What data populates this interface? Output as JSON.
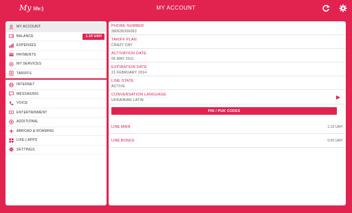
{
  "header": {
    "logo_my": "My",
    "logo_life": "life:)",
    "title": "MY ACCOUNT",
    "refresh_icon": "refresh-icon",
    "settings_icon": "gear-icon"
  },
  "sidebar": {
    "items": [
      {
        "label": "MY ACCOUNT",
        "icon": "user-icon"
      },
      {
        "label": "BALANCE",
        "icon": "wallet-icon",
        "badge": "1.19 UAH"
      },
      {
        "label": "EXPENSES",
        "icon": "chart-icon"
      },
      {
        "label": "PAYMENTS",
        "icon": "card-icon"
      },
      {
        "label": "MY SERVICES",
        "icon": "services-icon"
      },
      {
        "label": "TARIFFS",
        "icon": "tariffs-icon"
      },
      {
        "label": "INTERNET",
        "icon": "globe-icon"
      },
      {
        "label": "MESSAGING",
        "icon": "message-icon"
      },
      {
        "label": "VOICE",
        "icon": "phone-icon"
      },
      {
        "label": "ENTERTAINMENT",
        "icon": "entertainment-icon"
      },
      {
        "label": "ADDITIONAL",
        "icon": "plus-icon"
      },
      {
        "label": "ABROAD & ROAMING",
        "icon": "plane-icon"
      },
      {
        "label": "LIFE:) APPS",
        "icon": "apps-icon"
      },
      {
        "label": "SETTINGS",
        "icon": "settings-icon"
      }
    ]
  },
  "account": {
    "phone_label": "PHONE NUMBER",
    "phone_value": "380636306063",
    "tariff_label": "TARIFF PLAN",
    "tariff_value": "CRAZY DAY",
    "activation_label": "ACTIVATION DATE",
    "activation_value": "06 MAY 2011",
    "expiration_label": "EXPIRATION DATE",
    "expiration_value": "21 FEBRUARY 2014",
    "line_state_label": "LINE STATE",
    "line_state_value": "ACTIVE",
    "language_label": "CONVERSATION LANGUAGE",
    "language_value": "UKRAINIAN LATIN",
    "pin_button": "PIN / PUK CODES",
    "line_main_label": "LINE MAIN",
    "line_main_value": "1.19 UAH",
    "line_bonus_label": "LINE BONUS",
    "line_bonus_value": "0.00 UAH"
  },
  "colors": {
    "accent": "#e2224f",
    "panel": "#ffffff",
    "active_item": "#ececec"
  }
}
